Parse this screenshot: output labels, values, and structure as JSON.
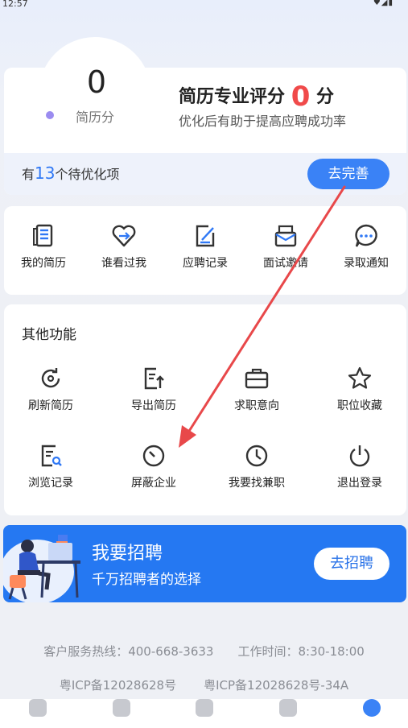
{
  "status_bar": {
    "time": "12:57"
  },
  "resume_score": {
    "value": "0",
    "label": "简历分",
    "eval_prefix": "简历专业评分",
    "eval_value": "0",
    "eval_unit": "分",
    "subtitle": "优化后有助于提高应聘成功率",
    "todo_prefix": "有",
    "todo_count": "13",
    "todo_suffix": "个待优化项",
    "improve_button": "去完善"
  },
  "quick_actions": [
    {
      "label": "我的简历",
      "icon": "resume-icon"
    },
    {
      "label": "谁看过我",
      "icon": "heart-icon"
    },
    {
      "label": "应聘记录",
      "icon": "edit-record-icon"
    },
    {
      "label": "面试邀请",
      "icon": "mail-icon"
    },
    {
      "label": "录取通知",
      "icon": "chat-icon"
    }
  ],
  "other_functions": {
    "title": "其他功能",
    "items": [
      {
        "label": "刷新简历",
        "icon": "refresh-icon"
      },
      {
        "label": "导出简历",
        "icon": "export-icon"
      },
      {
        "label": "求职意向",
        "icon": "briefcase-icon"
      },
      {
        "label": "职位收藏",
        "icon": "star-icon"
      },
      {
        "label": "浏览记录",
        "icon": "browse-icon"
      },
      {
        "label": "屏蔽企业",
        "icon": "block-icon"
      },
      {
        "label": "我要找兼职",
        "icon": "clock-icon"
      },
      {
        "label": "退出登录",
        "icon": "power-icon"
      }
    ]
  },
  "recruit_banner": {
    "title": "我要招聘",
    "subtitle": "千万招聘者的选择",
    "button": "去招聘"
  },
  "footer": {
    "hotline": "客户服务热线：400-668-3633",
    "hours": "工作时间：8:30-18:00",
    "icp1": "粤ICP备12028628号",
    "icp2": "粤ICP备12028628号-34A"
  },
  "annotation_color": "#e8484a",
  "colors": {
    "accent": "#3a82f6",
    "score_red": "#f04a4a",
    "banner": "#2578f2"
  }
}
